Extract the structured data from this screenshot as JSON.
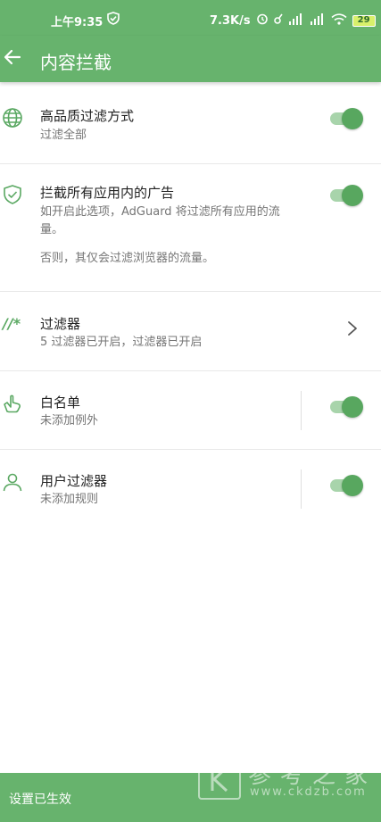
{
  "status_bar": {
    "time": "上午9:35",
    "network_speed": "7.3K/s",
    "battery": "29",
    "icons": [
      "shield-check-icon",
      "alarm-icon",
      "bluetooth-icon",
      "signal-icon",
      "signal-icon",
      "wifi-icon",
      "battery-icon"
    ]
  },
  "app_bar": {
    "title": "内容拦截",
    "back_icon": "arrow-left-icon"
  },
  "items": [
    {
      "icon": "globe-icon",
      "title": "高品质过滤方式",
      "subtitle": "过滤全部",
      "control": "toggle",
      "enabled": true
    },
    {
      "icon": "shield-check-icon",
      "title": "拦截所有应用内的广告",
      "subtitle": "如开启此选项，AdGuard 将过滤所有应用的流量。",
      "subtitle_extra": "否则，其仅会过滤浏览器的流量。",
      "control": "toggle",
      "enabled": true
    },
    {
      "icon": "filter-slashes-icon",
      "icon_text": "//*",
      "title": "过滤器",
      "subtitle": "5 过滤器已开启，过滤器已开启",
      "control": "chevron"
    },
    {
      "icon": "thumbs-up-icon",
      "title": "白名单",
      "subtitle": "未添加例外",
      "control": "toggle",
      "enabled": true
    },
    {
      "icon": "user-icon",
      "title": "用户过滤器",
      "subtitle": "未添加规则",
      "control": "toggle",
      "enabled": true
    }
  ],
  "footer": {
    "message": "设置已生效"
  },
  "watermark": {
    "text": "参考之家",
    "url": "www.ckdzb.com"
  },
  "colors": {
    "primary": "#67b36d",
    "toggle_thumb": "#58a75f",
    "toggle_track": "#a8d4ab",
    "icon": "#5aa862",
    "text_primary": "#222222",
    "text_secondary": "#757575"
  }
}
